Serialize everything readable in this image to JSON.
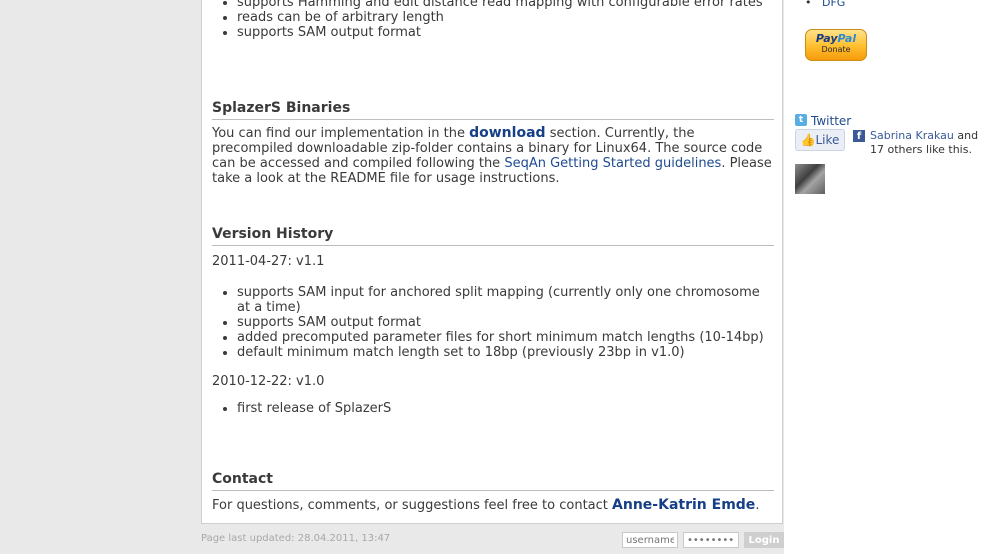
{
  "features": {
    "items": [
      "supports Hamming and edit distance read mapping with configurable error rates",
      "reads can be of arbitrary length",
      "supports SAM output format"
    ]
  },
  "binaries": {
    "heading": "SplazerS Binaries",
    "text_before_download": "You can find our implementation in the",
    "download_link": "download",
    "text_middle": "section. Currently, the precompiled downloadable zip-folder contains a binary for Linux64. The source code can be accessed and compiled following the",
    "seqan_link": "SeqAn Getting Started guidelines",
    "text_after": ". Please take a look at the README file for usage instructions."
  },
  "history": {
    "heading": "Version History",
    "versions": [
      {
        "title": "2011-04-27: v1.1",
        "items": [
          "supports SAM input for anchored split mapping (currently only one chromosome at a time)",
          "supports SAM output format",
          "added precomputed parameter files for short minimum match lengths (10-14bp)",
          "default minimum match length set to 18bp (previously 23bp in v1.0)"
        ]
      },
      {
        "title": "2010-12-22: v1.0",
        "items": [
          "first release of SplazerS"
        ]
      }
    ]
  },
  "contact": {
    "heading": "Contact",
    "text": "For questions, comments, or suggestions feel free to contact",
    "link": "Anne-Katrin Emde",
    "suffix": "."
  },
  "footer": {
    "last_updated": "Page last updated: 28.04.2011, 13:47",
    "username_placeholder": "username",
    "password_placeholder": "••••••••",
    "login_label": "Login"
  },
  "sidebar": {
    "top_link": "DFG",
    "paypal_brand_pay": "Pay",
    "paypal_brand_pal": "Pal",
    "paypal_donate": "Donate",
    "twitter_icon": "t",
    "twitter_label": "Twitter",
    "like_label": "Like",
    "facebook_icon": "f",
    "fb_name": "Sabrina Krakau",
    "fb_text": "and 17 others like this."
  }
}
